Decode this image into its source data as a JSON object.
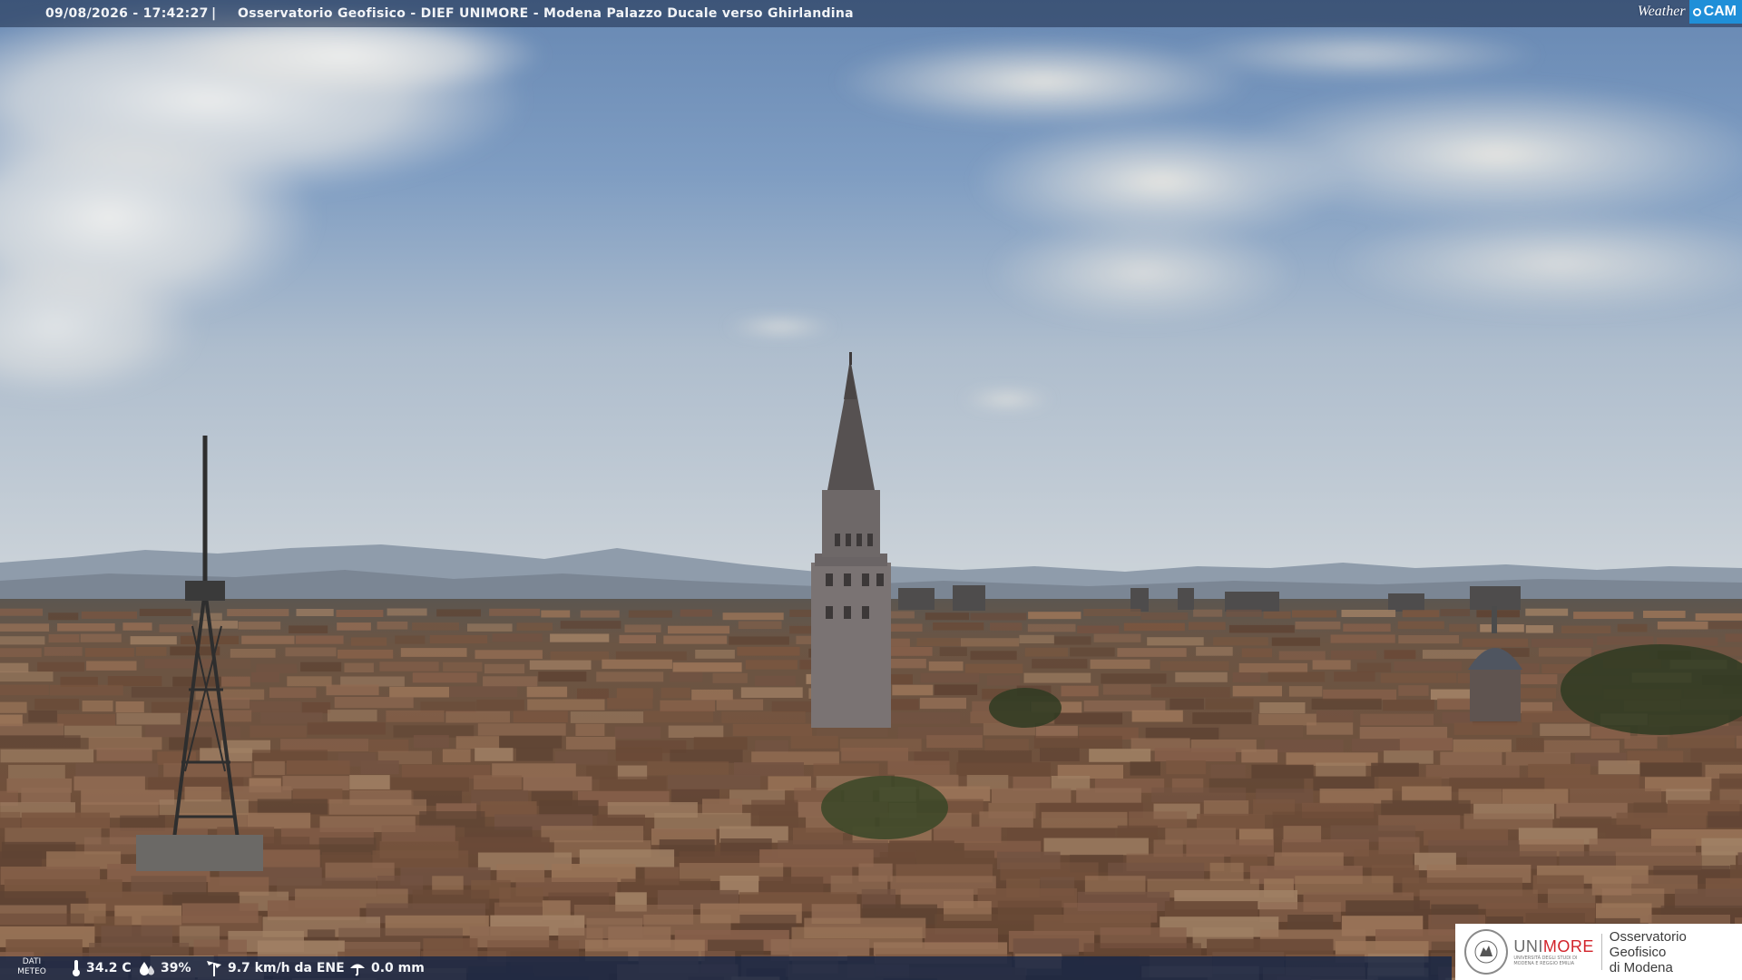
{
  "camera": {
    "timestamp": "09/08/2026 - 17:42:27",
    "separator": "|",
    "title": "Osservatorio Geofisico - DIEF UNIMORE - Modena Palazzo Ducale verso Ghirlandina",
    "brand_weather": "Weather",
    "brand_cam": "CAM"
  },
  "weather": {
    "label_line1": "DATI",
    "label_line2": "METEO",
    "temperature": "34.2 C",
    "humidity": "39%",
    "wind": "9.7 km/h da ENE",
    "rain": "0.0 mm",
    "icons": [
      "thermometer-icon",
      "humidity-icon",
      "wind-icon",
      "rain-icon"
    ]
  },
  "logo": {
    "uni_part1": "UNI",
    "uni_part2": "MORE",
    "uni_sub1": "UNIVERSITÀ DEGLI STUDI DI",
    "uni_sub2": "MODENA E REGGIO EMILIA",
    "obs_line1": "Osservatorio Geofisico",
    "obs_line2": "di Modena"
  },
  "colors": {
    "sky_top": "#6f8fb8",
    "sky_horizon": "#c9d2da",
    "roofs": "#6b4a36",
    "unimore_red": "#d2232a",
    "weathercam_blue": "#1f8fd8"
  }
}
